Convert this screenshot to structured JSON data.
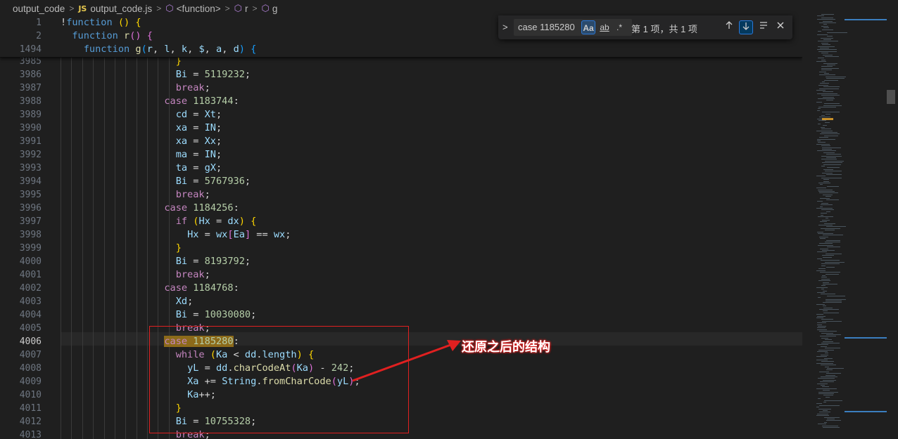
{
  "breadcrumb": {
    "folder": "output_code",
    "file_badge": "JS",
    "file": "output_code.js",
    "symbols": [
      "<function>",
      "r",
      "g"
    ]
  },
  "find": {
    "query": "case 1185280",
    "match_case": "Aa",
    "whole_word": "ab",
    "regex": ".*",
    "result": "第 1 项，共 1 项",
    "prev_icon": "arrow-up-icon",
    "next_icon": "arrow-down-icon",
    "selection_icon": "find-in-selection-icon",
    "close_icon": "close-icon"
  },
  "sticky": [
    {
      "ln": "1",
      "tokens": [
        [
          "p",
          "!"
        ],
        [
          "k",
          "function"
        ],
        [
          "p",
          " "
        ],
        [
          "b1",
          "()"
        ],
        [
          "p",
          " "
        ],
        [
          "b1",
          "{"
        ]
      ]
    },
    {
      "ln": "2",
      "tokens": [
        [
          "p",
          "  "
        ],
        [
          "k",
          "function"
        ],
        [
          "p",
          " "
        ],
        [
          "f",
          "r"
        ],
        [
          "b2",
          "()"
        ],
        [
          "p",
          " "
        ],
        [
          "b2",
          "{"
        ]
      ]
    },
    {
      "ln": "1494",
      "tokens": [
        [
          "p",
          "    "
        ],
        [
          "k",
          "function"
        ],
        [
          "p",
          " "
        ],
        [
          "f",
          "g"
        ],
        [
          "b3",
          "("
        ],
        [
          "v",
          "r"
        ],
        [
          "p",
          ", "
        ],
        [
          "v",
          "l"
        ],
        [
          "p",
          ", "
        ],
        [
          "v",
          "k"
        ],
        [
          "p",
          ", "
        ],
        [
          "v",
          "$"
        ],
        [
          "p",
          ", "
        ],
        [
          "v",
          "a"
        ],
        [
          "p",
          ", "
        ],
        [
          "v",
          "d"
        ],
        [
          "b3",
          ")"
        ],
        [
          "p",
          " "
        ],
        [
          "b3",
          "{"
        ]
      ]
    }
  ],
  "lines": [
    {
      "ln": "3985",
      "tokens": [
        [
          "p",
          "                    "
        ],
        [
          "b1",
          "}"
        ]
      ]
    },
    {
      "ln": "3986",
      "tokens": [
        [
          "p",
          "                    "
        ],
        [
          "v",
          "Bi"
        ],
        [
          "p",
          " = "
        ],
        [
          "n",
          "5119232"
        ],
        [
          "p",
          ";"
        ]
      ]
    },
    {
      "ln": "3987",
      "tokens": [
        [
          "p",
          "                    "
        ],
        [
          "kc",
          "break"
        ],
        [
          "p",
          ";"
        ]
      ]
    },
    {
      "ln": "3988",
      "tokens": [
        [
          "p",
          "                  "
        ],
        [
          "kc",
          "case"
        ],
        [
          "p",
          " "
        ],
        [
          "n",
          "1183744"
        ],
        [
          "p",
          ":"
        ]
      ]
    },
    {
      "ln": "3989",
      "tokens": [
        [
          "p",
          "                    "
        ],
        [
          "v",
          "cd"
        ],
        [
          "p",
          " = "
        ],
        [
          "v",
          "Xt"
        ],
        [
          "p",
          ";"
        ]
      ]
    },
    {
      "ln": "3990",
      "tokens": [
        [
          "p",
          "                    "
        ],
        [
          "v",
          "xa"
        ],
        [
          "p",
          " = "
        ],
        [
          "v",
          "IN"
        ],
        [
          "p",
          ";"
        ]
      ]
    },
    {
      "ln": "3991",
      "tokens": [
        [
          "p",
          "                    "
        ],
        [
          "v",
          "xa"
        ],
        [
          "p",
          " = "
        ],
        [
          "v",
          "Xx"
        ],
        [
          "p",
          ";"
        ]
      ]
    },
    {
      "ln": "3992",
      "tokens": [
        [
          "p",
          "                    "
        ],
        [
          "v",
          "ma"
        ],
        [
          "p",
          " = "
        ],
        [
          "v",
          "IN"
        ],
        [
          "p",
          ";"
        ]
      ]
    },
    {
      "ln": "3993",
      "tokens": [
        [
          "p",
          "                    "
        ],
        [
          "v",
          "ta"
        ],
        [
          "p",
          " = "
        ],
        [
          "v",
          "gX"
        ],
        [
          "p",
          ";"
        ]
      ]
    },
    {
      "ln": "3994",
      "tokens": [
        [
          "p",
          "                    "
        ],
        [
          "v",
          "Bi"
        ],
        [
          "p",
          " = "
        ],
        [
          "n",
          "5767936"
        ],
        [
          "p",
          ";"
        ]
      ]
    },
    {
      "ln": "3995",
      "tokens": [
        [
          "p",
          "                    "
        ],
        [
          "kc",
          "break"
        ],
        [
          "p",
          ";"
        ]
      ]
    },
    {
      "ln": "3996",
      "tokens": [
        [
          "p",
          "                  "
        ],
        [
          "kc",
          "case"
        ],
        [
          "p",
          " "
        ],
        [
          "n",
          "1184256"
        ],
        [
          "p",
          ":"
        ]
      ]
    },
    {
      "ln": "3997",
      "tokens": [
        [
          "p",
          "                    "
        ],
        [
          "kc",
          "if"
        ],
        [
          "p",
          " "
        ],
        [
          "b1",
          "("
        ],
        [
          "v",
          "Hx"
        ],
        [
          "p",
          " = "
        ],
        [
          "v",
          "dx"
        ],
        [
          "b1",
          ")"
        ],
        [
          "p",
          " "
        ],
        [
          "b1",
          "{"
        ]
      ]
    },
    {
      "ln": "3998",
      "tokens": [
        [
          "p",
          "                      "
        ],
        [
          "v",
          "Hx"
        ],
        [
          "p",
          " = "
        ],
        [
          "v",
          "wx"
        ],
        [
          "b2",
          "["
        ],
        [
          "v",
          "Ea"
        ],
        [
          "b2",
          "]"
        ],
        [
          "p",
          " == "
        ],
        [
          "v",
          "wx"
        ],
        [
          "p",
          ";"
        ]
      ]
    },
    {
      "ln": "3999",
      "tokens": [
        [
          "p",
          "                    "
        ],
        [
          "b1",
          "}"
        ]
      ]
    },
    {
      "ln": "4000",
      "tokens": [
        [
          "p",
          "                    "
        ],
        [
          "v",
          "Bi"
        ],
        [
          "p",
          " = "
        ],
        [
          "n",
          "8193792"
        ],
        [
          "p",
          ";"
        ]
      ]
    },
    {
      "ln": "4001",
      "tokens": [
        [
          "p",
          "                    "
        ],
        [
          "kc",
          "break"
        ],
        [
          "p",
          ";"
        ]
      ]
    },
    {
      "ln": "4002",
      "tokens": [
        [
          "p",
          "                  "
        ],
        [
          "kc",
          "case"
        ],
        [
          "p",
          " "
        ],
        [
          "n",
          "1184768"
        ],
        [
          "p",
          ":"
        ]
      ]
    },
    {
      "ln": "4003",
      "tokens": [
        [
          "p",
          "                    "
        ],
        [
          "v",
          "Xd"
        ],
        [
          "p",
          ";"
        ]
      ]
    },
    {
      "ln": "4004",
      "tokens": [
        [
          "p",
          "                    "
        ],
        [
          "v",
          "Bi"
        ],
        [
          "p",
          " = "
        ],
        [
          "n",
          "10030080"
        ],
        [
          "p",
          ";"
        ]
      ]
    },
    {
      "ln": "4005",
      "tokens": [
        [
          "p",
          "                    "
        ],
        [
          "kc",
          "break"
        ],
        [
          "p",
          ";"
        ]
      ]
    },
    {
      "ln": "4006",
      "active": true,
      "tokens": [
        [
          "p",
          "                  "
        ],
        [
          "hl",
          "case"
        ],
        [
          "hl",
          " "
        ],
        [
          "hln",
          "1185280"
        ],
        [
          "p",
          ":"
        ]
      ]
    },
    {
      "ln": "4007",
      "tokens": [
        [
          "p",
          "                    "
        ],
        [
          "kc",
          "while"
        ],
        [
          "p",
          " "
        ],
        [
          "b1",
          "("
        ],
        [
          "v",
          "Ka"
        ],
        [
          "p",
          " < "
        ],
        [
          "v",
          "dd"
        ],
        [
          "p",
          "."
        ],
        [
          "v",
          "length"
        ],
        [
          "b1",
          ")"
        ],
        [
          "p",
          " "
        ],
        [
          "b1",
          "{"
        ]
      ]
    },
    {
      "ln": "4008",
      "tokens": [
        [
          "p",
          "                      "
        ],
        [
          "v",
          "yL"
        ],
        [
          "p",
          " = "
        ],
        [
          "v",
          "dd"
        ],
        [
          "p",
          "."
        ],
        [
          "f",
          "charCodeAt"
        ],
        [
          "b2",
          "("
        ],
        [
          "v",
          "Ka"
        ],
        [
          "b2",
          ")"
        ],
        [
          "p",
          " - "
        ],
        [
          "n",
          "242"
        ],
        [
          "p",
          ";"
        ]
      ]
    },
    {
      "ln": "4009",
      "tokens": [
        [
          "p",
          "                      "
        ],
        [
          "v",
          "Xa"
        ],
        [
          "p",
          " += "
        ],
        [
          "v",
          "String"
        ],
        [
          "p",
          "."
        ],
        [
          "f",
          "fromCharCode"
        ],
        [
          "b2",
          "("
        ],
        [
          "v",
          "yL"
        ],
        [
          "b2",
          ")"
        ],
        [
          "p",
          ";"
        ]
      ]
    },
    {
      "ln": "4010",
      "tokens": [
        [
          "p",
          "                      "
        ],
        [
          "v",
          "Ka"
        ],
        [
          "p",
          "++;"
        ]
      ]
    },
    {
      "ln": "4011",
      "tokens": [
        [
          "p",
          "                    "
        ],
        [
          "b1",
          "}"
        ]
      ]
    },
    {
      "ln": "4012",
      "tokens": [
        [
          "p",
          "                    "
        ],
        [
          "v",
          "Bi"
        ],
        [
          "p",
          " = "
        ],
        [
          "n",
          "10755328"
        ],
        [
          "p",
          ";"
        ]
      ]
    },
    {
      "ln": "4013",
      "tokens": [
        [
          "p",
          "                    "
        ],
        [
          "kc",
          "break"
        ],
        [
          "p",
          ";"
        ]
      ]
    }
  ],
  "annotation": {
    "text": "还原之后的结构",
    "color": "#e02020"
  },
  "colors": {
    "background": "#1f1f1f",
    "keyword": "#569cd6",
    "control": "#c586c0",
    "number": "#b5cea8",
    "variable": "#9cdcfe",
    "function": "#dcdcaa",
    "highlight": "#8c6a1a"
  }
}
